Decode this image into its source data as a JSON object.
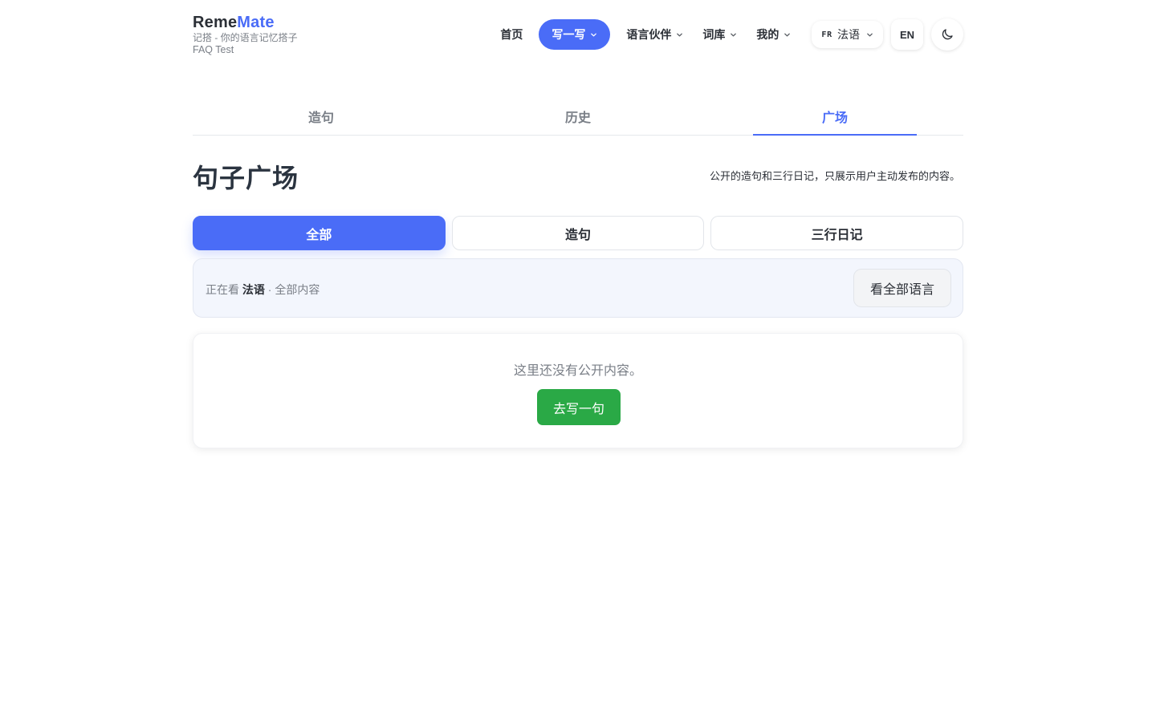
{
  "brand": {
    "name_part1": "Reme",
    "name_part2": "Mate",
    "subtitle": "记搭 - 你的语言记忆搭子",
    "subtitle2": "FAQ Test",
    "accent_color": "#4a6cf7"
  },
  "nav": {
    "items": [
      {
        "label": "首页",
        "has_dropdown": false,
        "active": false
      },
      {
        "label": "写一写",
        "has_dropdown": true,
        "active": true
      },
      {
        "label": "语言伙伴",
        "has_dropdown": true,
        "active": false
      },
      {
        "label": "词库",
        "has_dropdown": true,
        "active": false
      },
      {
        "label": "我的",
        "has_dropdown": true,
        "active": false
      }
    ],
    "language_code": "FR",
    "language_label": "法语",
    "ui_language": "EN",
    "theme_icon": "moon-icon"
  },
  "tabs": [
    {
      "label": "造句",
      "active": false
    },
    {
      "label": "历史",
      "active": false
    },
    {
      "label": "广场",
      "active": true
    }
  ],
  "page": {
    "title": "句子广场",
    "description": "公开的造句和三行日记，只展示用户主动发布的内容。"
  },
  "filters": [
    {
      "label": "全部",
      "active": true
    },
    {
      "label": "造句",
      "active": false
    },
    {
      "label": "三行日记",
      "active": false
    }
  ],
  "info": {
    "prefix": "正在看",
    "language": "法语",
    "suffix": "· 全部内容",
    "button_label": "看全部语言"
  },
  "empty_state": {
    "message": "这里还没有公开内容。",
    "button_label": "去写一句",
    "button_color": "#2aa946"
  }
}
